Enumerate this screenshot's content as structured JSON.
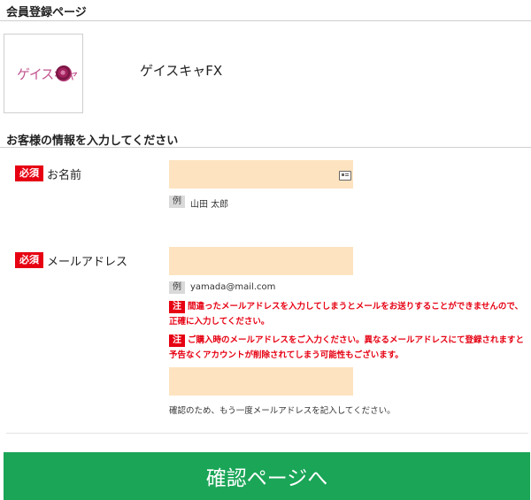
{
  "page_title": "会員登録ページ",
  "shop": {
    "name": "ゲイスキャFX",
    "logo_text": "ゲイスキャ"
  },
  "section_title": "お客様の情報を入力してください",
  "required_label": "必須",
  "example_label": "例",
  "note_label": "注",
  "name_field": {
    "label": "お名前",
    "value": "",
    "example": "山田 太郎"
  },
  "email_field": {
    "label": "メールアドレス",
    "value": "",
    "example": "yamada@mail.com",
    "notes": [
      "間違ったメールアドレスを入力してしまうとメールをお送りすることができませんので、正確に入力してください。",
      "ご購入時のメールアドレスをご入力ください。異なるメールアドレスにて登録されますと予告なくアカウントが削除されてしまう可能性もございます。"
    ],
    "confirm_value": "",
    "confirm_hint": "確認のため、もう一度メールアドレスを記入してください。"
  },
  "submit_label": "確認ページへ",
  "colors": {
    "required": "#e60012",
    "input_bg": "#fde3c0",
    "button": "#1aa557",
    "logo": "#c25590"
  }
}
